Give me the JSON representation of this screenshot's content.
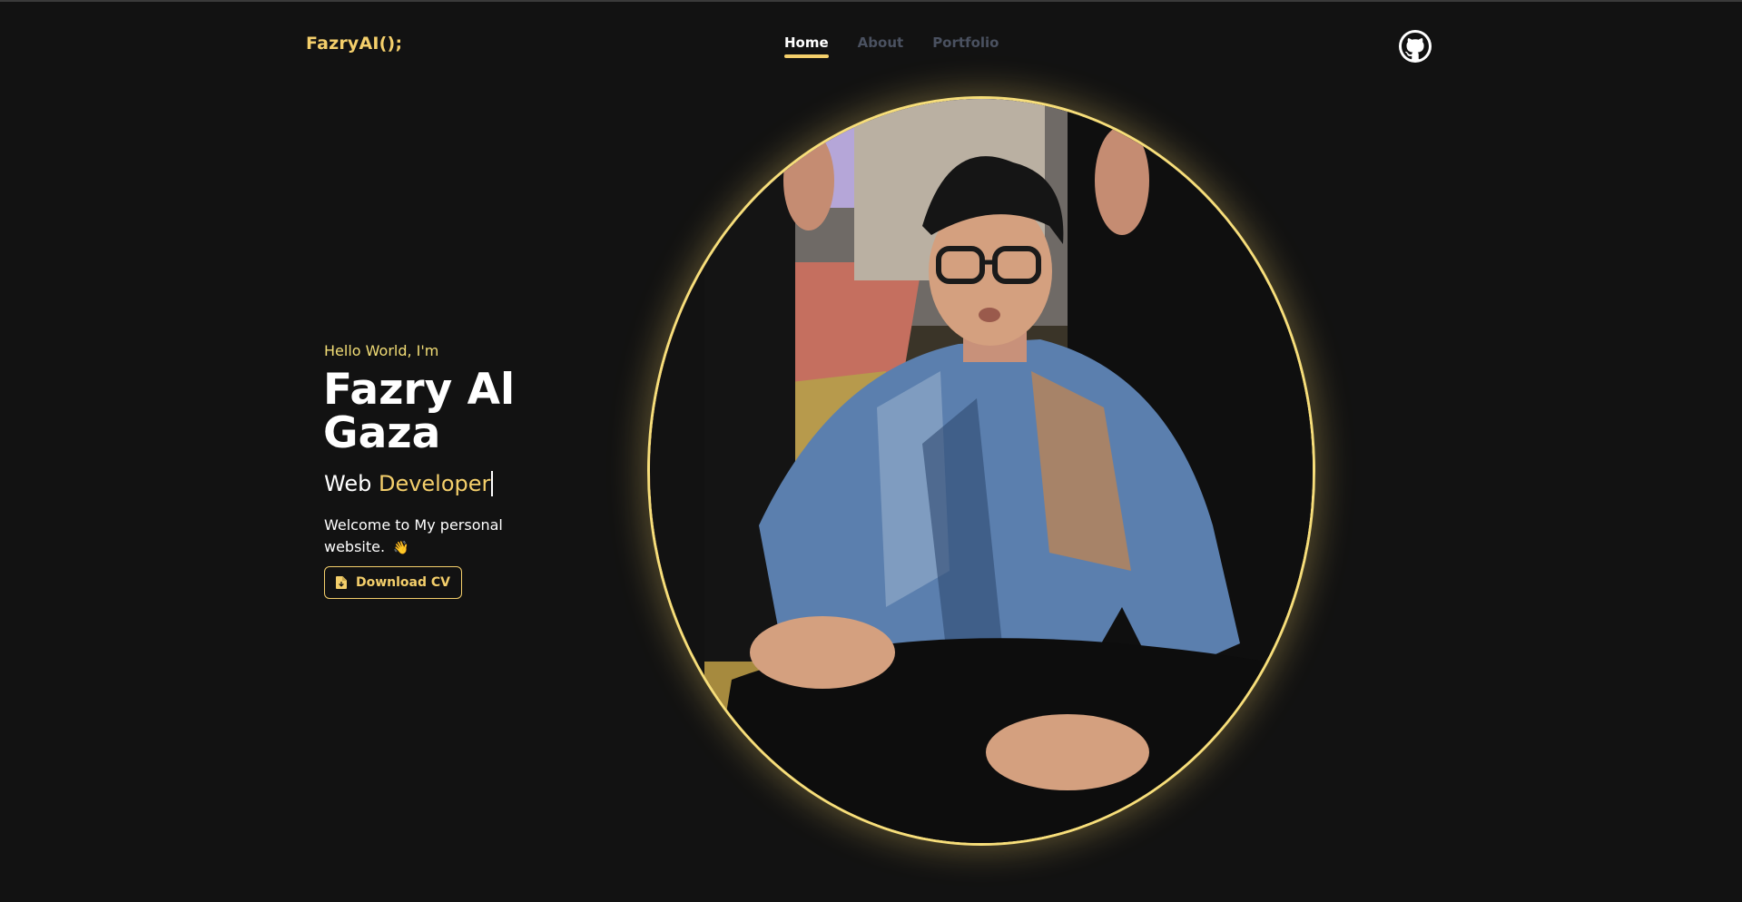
{
  "navbar": {
    "brand": "FazryAI();",
    "links": [
      {
        "label": "Home",
        "active": true
      },
      {
        "label": "About",
        "active": false
      },
      {
        "label": "Portfolio",
        "active": false
      }
    ],
    "github_icon": "github-icon"
  },
  "hero": {
    "greeting": "Hello World, I'm",
    "name": "Fazry Al Gaza",
    "role_prefix": "Web",
    "role_typed": "Developer",
    "welcome": "Welcome to My personal website.",
    "wave_emoji": "👋",
    "cv_button": {
      "label": "Download CV",
      "icon": "file-icon"
    }
  },
  "colors": {
    "background": "#121212",
    "accent": "#f4cf6b",
    "greeting": "#f2dd76",
    "nav_inactive": "#4a5160",
    "frame": "#f7de7a"
  }
}
